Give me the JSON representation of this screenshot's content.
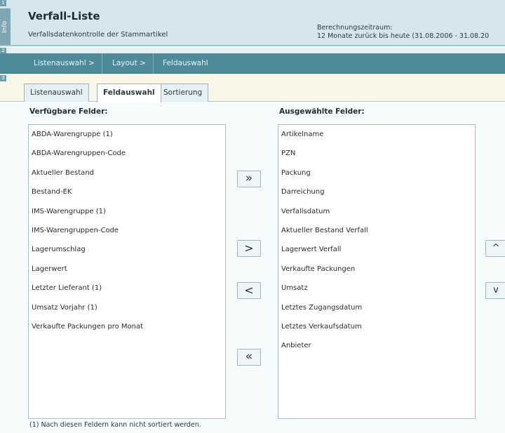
{
  "header": {
    "section_number": "1",
    "info_label": "Info",
    "title": "Verfall-Liste",
    "subtitle": "Verfallsdatenkontrolle der Stammartikel",
    "calc_label": "Berechnungszeitraum:",
    "calc_value": "12 Monate zurück bis heute (31.08.2006 - 31.08.20"
  },
  "nav": {
    "section_number": "2",
    "items": [
      {
        "label": "Listenauswahl >"
      },
      {
        "label": "Layout >"
      },
      {
        "label": "Feldauswahl"
      }
    ]
  },
  "tabs": {
    "section_number": "3",
    "items": [
      {
        "label": "Listenauswahl",
        "active": false
      },
      {
        "label": "Feldauswahl",
        "active": true
      },
      {
        "label": "Sortierung",
        "active": false
      }
    ]
  },
  "available": {
    "heading": "Verfügbare Felder:",
    "items": [
      "ABDA-Warengruppe (1)",
      "ABDA-Warengruppen-Code",
      "Aktueller Bestand",
      "Bestand-EK",
      "IMS-Warengruppe (1)",
      "IMS-Warengruppen-Code",
      "Lagerumschlag",
      "Lagerwert",
      "Letzter Lieferant (1)",
      "Umsatz Vorjahr (1)",
      "Verkaufte Packungen pro Monat"
    ]
  },
  "selected": {
    "heading": "Ausgewählte Felder:",
    "items": [
      "Artikelname",
      "PZN",
      "Packung",
      "Darreichung",
      "Verfallsdatum",
      "Aktueller Bestand Verfall",
      "Lagerwert Verfall",
      "Verkaufte Packungen",
      "Umsatz",
      "Letztes Zugangsdatum",
      "Letztes Verkaufsdatum",
      "Anbieter"
    ]
  },
  "buttons": {
    "add_all": "»",
    "add_one": ">",
    "remove_one": "<",
    "remove_all": "«",
    "move_up": "^",
    "move_down": "v"
  },
  "footnote": "(1) Nach diesen Feldern kann nicht sortiert werden.",
  "colors": {
    "header_bg": "#d5e7ec",
    "nav_bg": "#4f8a9b",
    "tabstrip_bg": "#fbf7e6",
    "content_bg": "#f6fbfc"
  }
}
